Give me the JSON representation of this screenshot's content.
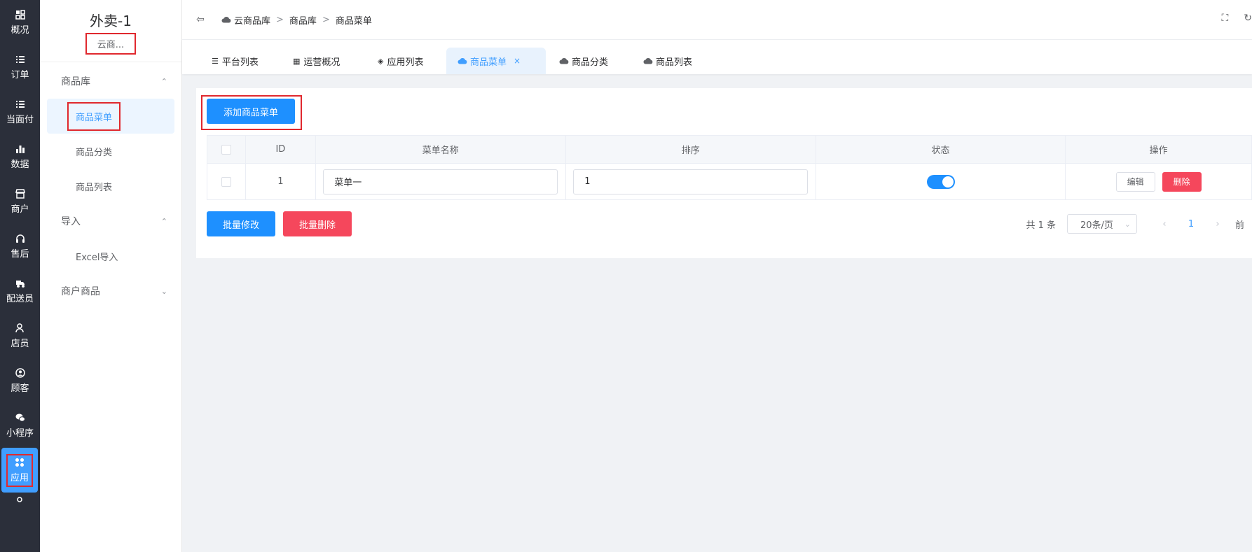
{
  "iconbar": {
    "items": [
      {
        "label": "概况",
        "icon": "dashboard-icon"
      },
      {
        "label": "订单",
        "icon": "list-icon"
      },
      {
        "label": "当面付",
        "icon": "list-icon"
      },
      {
        "label": "数据",
        "icon": "bar-chart-icon"
      },
      {
        "label": "商户",
        "icon": "store-icon"
      },
      {
        "label": "售后",
        "icon": "headset-icon"
      },
      {
        "label": "配送员",
        "icon": "delivery-icon"
      },
      {
        "label": "店员",
        "icon": "users-icon"
      },
      {
        "label": "顾客",
        "icon": "user-circle-icon"
      },
      {
        "label": "小程序",
        "icon": "wechat-icon"
      },
      {
        "label": "应用",
        "icon": "apps-icon"
      }
    ]
  },
  "subbar": {
    "title": "外卖-1",
    "subtitle": "云商...",
    "groups": [
      {
        "label": "商品库",
        "expanded": true,
        "items": [
          "商品菜单",
          "商品分类",
          "商品列表"
        ]
      },
      {
        "label": "导入",
        "expanded": true,
        "items": [
          "Excel导入"
        ]
      },
      {
        "label": "商户商品",
        "expanded": false,
        "items": []
      }
    ]
  },
  "header": {
    "breadcrumb": [
      "云商品库",
      "商品库",
      "商品菜单"
    ],
    "separator": ">"
  },
  "tabs": [
    {
      "label": "平台列表",
      "icon": "list-icon"
    },
    {
      "label": "运营概况",
      "icon": "dashboard-icon"
    },
    {
      "label": "应用列表",
      "icon": "apps-icon"
    },
    {
      "label": "商品菜单",
      "icon": "cloud-icon",
      "active": true,
      "closable": true
    },
    {
      "label": "商品分类",
      "icon": "cloud-icon"
    },
    {
      "label": "商品列表",
      "icon": "cloud-icon"
    }
  ],
  "main": {
    "add_button": "添加商品菜单",
    "table": {
      "columns": [
        "ID",
        "菜单名称",
        "排序",
        "状态",
        "操作"
      ],
      "rows": [
        {
          "id": "1",
          "name": "菜单一",
          "sort": "1",
          "status": true,
          "edit": "编辑",
          "delete": "删除"
        }
      ]
    },
    "batch_edit": "批量修改",
    "batch_delete": "批量删除",
    "pager": {
      "total": "共 1 条",
      "page_size": "20条/页",
      "current_page": "1",
      "goto": "前"
    }
  },
  "colors": {
    "primary": "#1e90ff",
    "danger": "#f5475c",
    "sidebar_bg": "#2b2f3a",
    "highlight": "#e0282e"
  }
}
